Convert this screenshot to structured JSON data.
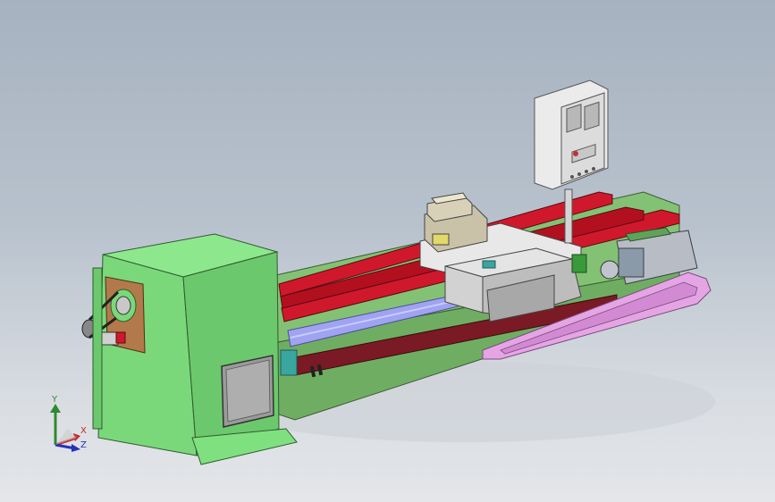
{
  "viewport": {
    "background_top": "#a7b2c0",
    "background_bottom": "#e4e6e9"
  },
  "model": {
    "headstock_color": "#7fe07f",
    "bed_color": "#7ab86a",
    "rail_color": "#c8172a",
    "leadscrew_color": "#9fa3f0",
    "carriage_color": "#d5d5d5",
    "cable_chain_color": "#e5a5e5",
    "pulley_color": "#b27a4a",
    "control_panel_color": "#e8e8e8"
  },
  "triad": {
    "y_label": "Y",
    "x_label": "X",
    "z_label": "Z",
    "y_color": "#2d8a2d",
    "x_color": "#c0282a",
    "z_color": "#2432b8",
    "icons": [
      "axis-triad-icon"
    ]
  }
}
